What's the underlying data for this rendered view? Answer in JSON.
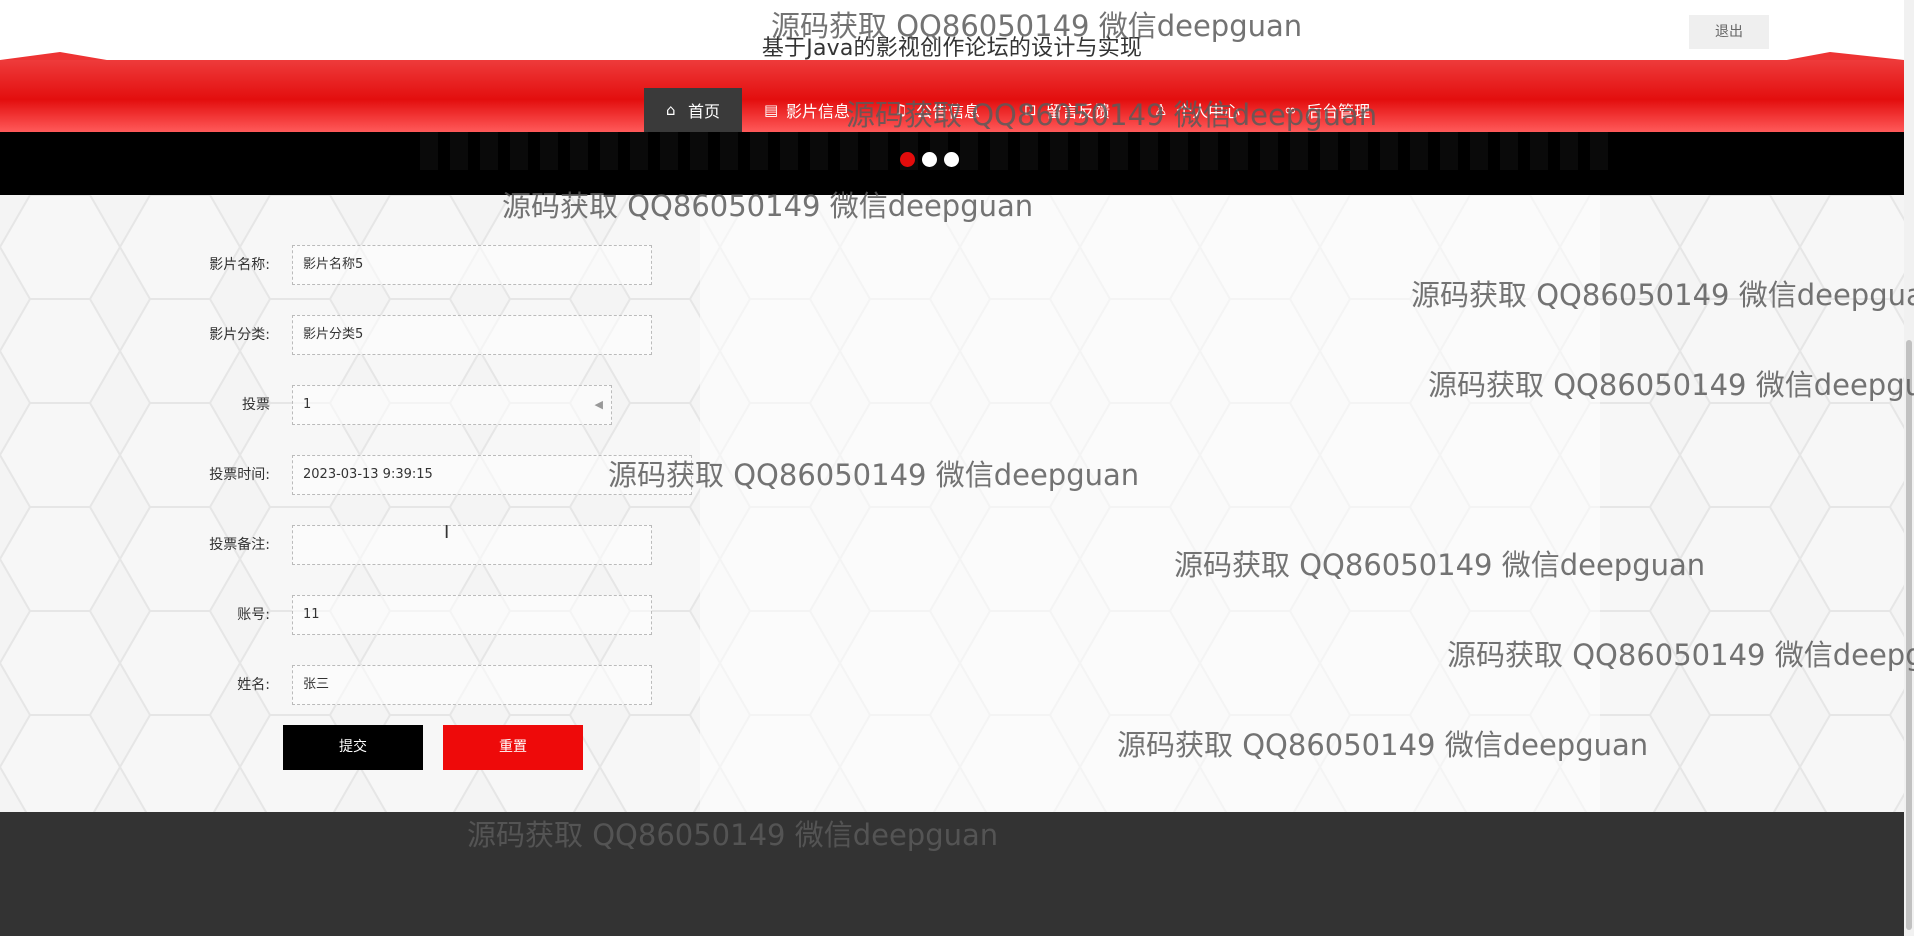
{
  "header": {
    "title": "基于Java的影视创作论坛的设计与实现",
    "logout_label": "退出"
  },
  "nav": {
    "items": [
      {
        "label": "首页",
        "icon": "home-icon"
      },
      {
        "label": "影片信息",
        "icon": "film-icon"
      },
      {
        "label": "公告信息",
        "icon": "notice-icon"
      },
      {
        "label": "留言反馈",
        "icon": "message-icon"
      },
      {
        "label": "个人中心",
        "icon": "user-icon"
      },
      {
        "label": "后台管理",
        "icon": "link-icon"
      }
    ]
  },
  "carousel": {
    "active_index": 0,
    "count": 3
  },
  "form": {
    "film_name": {
      "label": "影片名称:",
      "value": "影片名称5"
    },
    "film_category": {
      "label": "影片分类:",
      "value": "影片分类5"
    },
    "vote": {
      "label": "投票",
      "value": "1"
    },
    "vote_time": {
      "label": "投票时间:",
      "value": "2023-03-13 9:39:15"
    },
    "vote_note": {
      "label": "投票备注:",
      "value": ""
    },
    "account": {
      "label": "账号:",
      "value": "11"
    },
    "name": {
      "label": "姓名:",
      "value": "张三"
    },
    "submit_label": "提交",
    "reset_label": "重置"
  },
  "watermark": "源码获取 QQ86050149 微信deepguan",
  "colors": {
    "accent": "#e30e0e",
    "dark": "#333333",
    "nav_active": "#3a3a3a"
  }
}
